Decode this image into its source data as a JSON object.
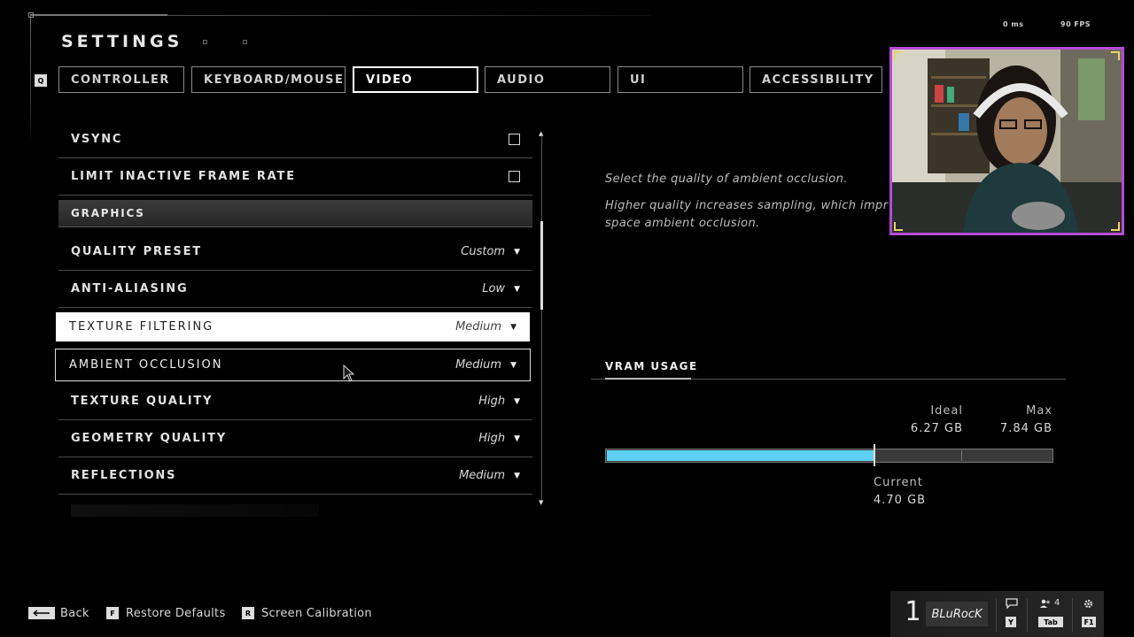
{
  "title": "SETTINGS",
  "perf": {
    "latency": "0 ms",
    "fps": "90 FPS"
  },
  "tabs": {
    "prev_key": "Q",
    "items": [
      {
        "label": "CONTROLLER"
      },
      {
        "label": "KEYBOARD/MOUSE"
      },
      {
        "label": "VIDEO",
        "active": true
      },
      {
        "label": "AUDIO"
      },
      {
        "label": "UI"
      },
      {
        "label": "ACCESSIBILITY"
      }
    ]
  },
  "settings": {
    "vsync": {
      "label": "VSYNC",
      "checked": false
    },
    "limit_inactive": {
      "label": "LIMIT INACTIVE FRAME RATE",
      "checked": false
    },
    "section_graphics": "GRAPHICS",
    "quality_preset": {
      "label": "QUALITY PRESET",
      "value": "Custom"
    },
    "anti_aliasing": {
      "label": "ANTI-ALIASING",
      "value": "Low"
    },
    "texture_filtering": {
      "label": "TEXTURE FILTERING",
      "value": "Medium"
    },
    "ambient_occlusion": {
      "label": "AMBIENT OCCLUSION",
      "value": "Medium"
    },
    "texture_quality": {
      "label": "TEXTURE QUALITY",
      "value": "High"
    },
    "geometry_quality": {
      "label": "GEOMETRY QUALITY",
      "value": "High"
    },
    "reflections": {
      "label": "REFLECTIONS",
      "value": "Medium"
    }
  },
  "description": {
    "line1": "Select the quality of ambient occlusion.",
    "line2": "Higher quality increases sampling, which impr",
    "line3": "space ambient occlusion."
  },
  "vram": {
    "title": "VRAM USAGE",
    "ideal_label": "Ideal",
    "ideal_value": "6.27 GB",
    "max_label": "Max",
    "max_value": "7.84 GB",
    "current_label": "Current",
    "current_value": "4.70 GB",
    "current_fraction": 0.6
  },
  "footer": {
    "back_label": "Back",
    "restore_key": "F",
    "restore_label": "Restore Defaults",
    "calibration_key": "R",
    "calibration_label": "Screen Calibration"
  },
  "player": {
    "rank": "1",
    "gamertag": "BLuRocK",
    "chat_key": "Y",
    "party_count": "4",
    "party_key": "Tab",
    "settings_key": "F1"
  },
  "colors": {
    "vram_fill": "#5ed1f2",
    "webcam_border": "#b44cd3"
  }
}
